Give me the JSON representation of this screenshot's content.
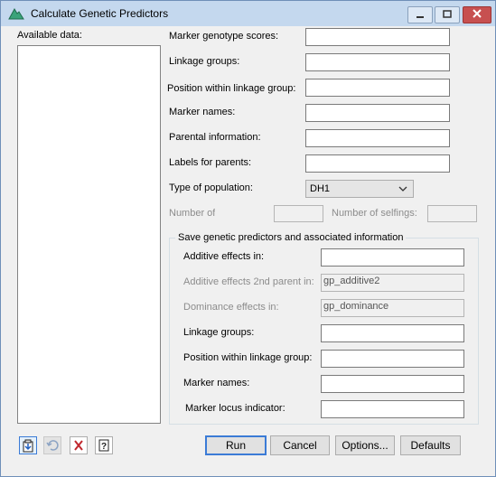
{
  "window": {
    "title": "Calculate Genetic Predictors"
  },
  "available_data": {
    "label": "Available data:"
  },
  "fields": {
    "marker_genotype_scores": {
      "label": "Marker genotype scores:",
      "value": ""
    },
    "linkage_groups": {
      "label": "Linkage groups:",
      "value": ""
    },
    "position_within_linkage_group": {
      "label": "Position within linkage group:",
      "value": ""
    },
    "marker_names": {
      "label": "Marker names:",
      "value": ""
    },
    "parental_information": {
      "label": "Parental information:",
      "value": ""
    },
    "labels_for_parents": {
      "label": "Labels for parents:",
      "value": ""
    },
    "type_of_population": {
      "label": "Type of population:",
      "selected": "DH1"
    },
    "number_of": {
      "label": "Number of",
      "value": ""
    },
    "number_of_selfings": {
      "label": "Number of selfings:",
      "value": ""
    }
  },
  "save_group": {
    "title": "Save genetic predictors and associated information",
    "additive_effects": {
      "label": "Additive effects in:",
      "value": ""
    },
    "additive_effects_2nd_parent": {
      "label": "Additive effects 2nd parent in:",
      "value": "gp_additive2"
    },
    "dominance_effects": {
      "label": "Dominance effects in:",
      "value": "gp_dominance"
    },
    "linkage_groups": {
      "label": "Linkage groups:",
      "value": ""
    },
    "position_within_linkage_group": {
      "label": "Position within linkage group:",
      "value": ""
    },
    "marker_names": {
      "label": "Marker names:",
      "value": ""
    },
    "marker_locus_indicator": {
      "label": "Marker locus indicator:",
      "value": ""
    }
  },
  "buttons": {
    "run": "Run",
    "cancel": "Cancel",
    "options": "Options...",
    "defaults": "Defaults"
  },
  "colors": {
    "accent": "#3b7bd6",
    "titlebar": "#c4d8ee",
    "close": "#c75050"
  }
}
